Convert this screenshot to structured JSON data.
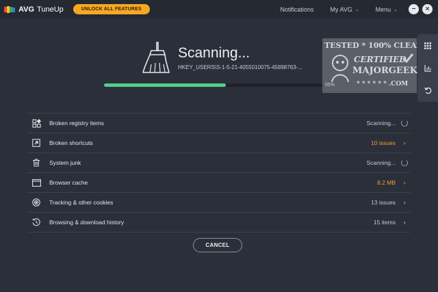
{
  "app": {
    "brand": "AVG",
    "product": "TuneUp"
  },
  "toolbar": {
    "unlock_label": "UNLOCK ALL FEATURES",
    "notifications_label": "Notifications",
    "myavg_label": "My AVG",
    "menu_label": "Menu",
    "minimize_glyph": "−",
    "close_glyph": "×"
  },
  "scan": {
    "title": "Scanning...",
    "path": "HKEY_USERS\\S-1-5-21-4055010075-45898763-...",
    "progress_percent": 54,
    "progress_label": "55%"
  },
  "watermark": {
    "line1": "TESTED * 100% CLEAN",
    "line2": "CERTIFIED",
    "line3": "MAJORGEEKS",
    "line4": "* * * * * * .COM"
  },
  "items": [
    {
      "label": "Broken registry items",
      "status": "Scanning...",
      "state": "scanning",
      "icon": "registry-icon"
    },
    {
      "label": "Broken shortcuts",
      "status": "10 issues",
      "state": "issue",
      "icon": "shortcut-icon"
    },
    {
      "label": "System junk",
      "status": "Scanning...",
      "state": "scanning",
      "icon": "trash-icon"
    },
    {
      "label": "Browser cache",
      "status": "8.2 MB",
      "state": "issue",
      "icon": "browser-icon"
    },
    {
      "label": "Tracking & other cookies",
      "status": "13 issues",
      "state": "done",
      "icon": "cookie-icon"
    },
    {
      "label": "Browsing & download history",
      "status": "15 items",
      "state": "done",
      "icon": "history-icon"
    }
  ],
  "actions": {
    "cancel_label": "CANCEL"
  },
  "colors": {
    "accent": "#f7a823",
    "progress": "#4cd18b",
    "issue": "#f4a02b",
    "background": "#2b2f3a"
  },
  "side_icons": [
    "grid-icon",
    "bar-chart-icon",
    "undo-icon"
  ]
}
